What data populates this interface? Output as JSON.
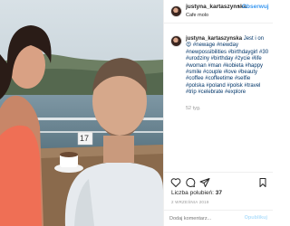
{
  "post": {
    "username": "justyna_kartaszynska",
    "follow_label": "Obserwuj",
    "dot": "•",
    "location": "Cafe molo",
    "caption_user": "justyna_kartaszynska",
    "caption_text": "Jest i on 😍 #newage #newday #newpossibilities #birthdaygirl #30 #urodziny #birthday #życie #life #woman #man #kobieta #happy #smile #couple #love #beauty #coffee #coffeetime #selfie #polska #poland #połsk #travel #trip #celebrate #explore",
    "caption_time": "52 tyg.",
    "likes_label": "Liczba polubień:",
    "likes_count": "37",
    "date": "2 WRZEŚNIA 2019",
    "comment_placeholder": "Dodaj komentarz...",
    "post_label": "Opublikuj"
  },
  "photo": {
    "table_number": "17"
  }
}
